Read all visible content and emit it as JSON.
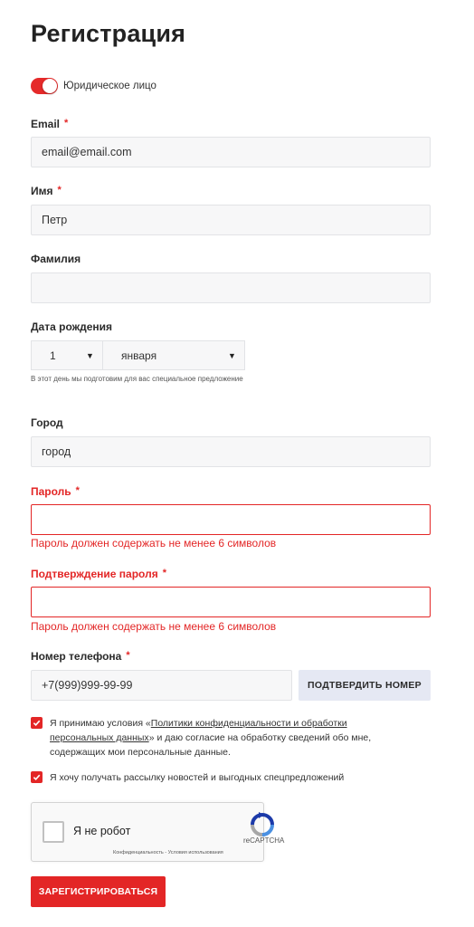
{
  "page": {
    "title": "Регистрация"
  },
  "legal_toggle": {
    "label": "Юридическое лицо",
    "on": true
  },
  "required_mark": "*",
  "email": {
    "label": "Email",
    "value": "email@email.com"
  },
  "first_name": {
    "label": "Имя",
    "value": "Петр"
  },
  "last_name": {
    "label": "Фамилия",
    "value": ""
  },
  "birth_date": {
    "label": "Дата рождения",
    "day": "1",
    "month": "января",
    "hint": "В этот день мы подготовим для вас специальное предложение"
  },
  "city": {
    "label": "Город",
    "value": "город"
  },
  "password": {
    "label": "Пароль",
    "value": "",
    "error": "Пароль должен содержать не менее 6 символов"
  },
  "password_confirm": {
    "label": "Подтверждение пароля",
    "value": "",
    "error": "Пароль должен содержать не менее 6 символов"
  },
  "phone": {
    "label": "Номер телефона",
    "value": "+7(999)999-99-99",
    "confirm_button": "ПОДТВЕРДИТЬ НОМЕР"
  },
  "consent": {
    "prefix": "Я принимаю условия «",
    "link": "Политики конфиденциальности и обработки персональных данных",
    "suffix": "» и даю согласие на обработку сведений обо мне, содержащих мои персональные данные.",
    "checked": true
  },
  "newsletter": {
    "label": "Я хочу получать рассылку новостей и выгодных спецпредложений",
    "checked": true
  },
  "captcha": {
    "label": "Я не робот",
    "brand": "reCAPTCHA",
    "links": "Конфиденциальность - Условия использования"
  },
  "submit_label": "ЗАРЕГИСТРИРОВАТЬСЯ",
  "colors": {
    "accent": "#e32626",
    "field_bg": "#f7f7f8",
    "button_secondary": "#e5e8f3"
  }
}
